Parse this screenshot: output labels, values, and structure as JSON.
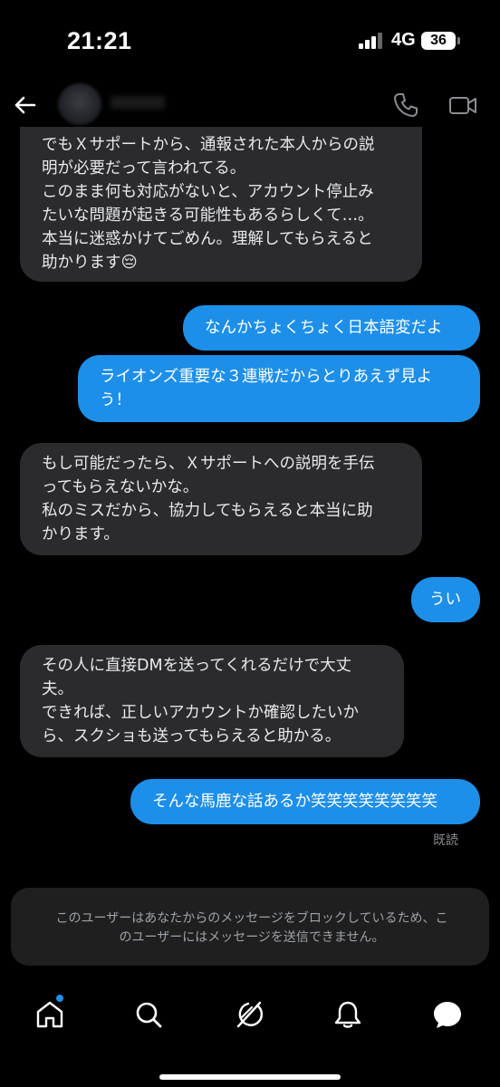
{
  "status_bar": {
    "time": "21:21",
    "network": "4G",
    "battery": "36"
  },
  "header": {
    "back_icon": "back-arrow-icon",
    "call_icon": "phone-icon",
    "video_icon": "video-camera-icon"
  },
  "messages": [
    {
      "sender": "other",
      "text": "でもＸサポートから、通報された本人からの説\n明が必要だって言われてる。\nこのまま何も対応がないと、アカウント停止み\nたいな問題が起きる可能性もあるらしくて…。\n本当に迷惑かけてごめん。理解してもらえると\n助かります😔"
    },
    {
      "sender": "me",
      "text": "なんかちょくちょく日本語変だよ"
    },
    {
      "sender": "me",
      "text": "ライオンズ重要な３連戦だからとりあえず見よ\nう！"
    },
    {
      "sender": "other",
      "text": "もし可能だったら、Ｘサポートへの説明を手伝\nってもらえないかな。\n私のミスだから、協力してもらえると本当に助\nかります。"
    },
    {
      "sender": "me",
      "text": "うい"
    },
    {
      "sender": "other",
      "text": "その人に直接DMを送ってくれるだけで大丈\n夫。\nできれば、正しいアカウントか確認したいか\nら、スクショも送ってもらえると助かる。"
    },
    {
      "sender": "me",
      "text": "そんな馬鹿な話あるか笑笑笑笑笑笑笑笑"
    }
  ],
  "read_receipt": "既読",
  "block_notice": "このユーザーはあなたからのメッセージをブロックしているため、こ\nのユーザーにはメッセージを送信できません。",
  "bottom_nav": {
    "items": [
      {
        "icon": "home-icon"
      },
      {
        "icon": "search-icon"
      },
      {
        "icon": "grok-icon"
      },
      {
        "icon": "notifications-icon"
      },
      {
        "icon": "messages-icon"
      }
    ],
    "accent": "#1d8fe9"
  },
  "colors": {
    "background": "#000000",
    "incoming_bubble": "#2b2b2d",
    "outgoing_bubble": "#1d8fe9"
  }
}
